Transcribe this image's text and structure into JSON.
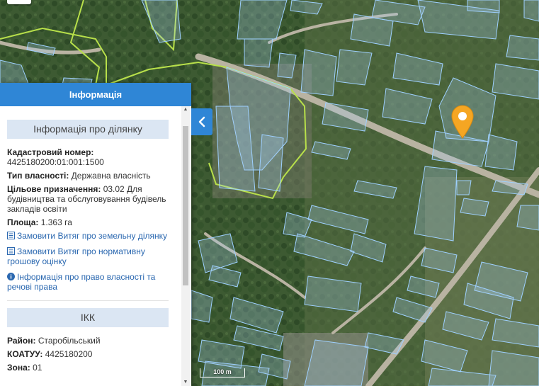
{
  "panel": {
    "title": "Інформація",
    "section_parcel": {
      "title": "Інформація про ділянку",
      "cadastral_label": "Кадастровий номер:",
      "cadastral_value": "4425180200:01:001:1500",
      "ownership_label": "Тип власності:",
      "ownership_value": "Державна власність",
      "purpose_label": "Цільове призначення:",
      "purpose_value": "03.02 Для будівництва та обслуговування будівель закладів освіти",
      "area_label": "Площа:",
      "area_value": "1.363 га"
    },
    "links": {
      "extract_land": "Замовити Витяг про земельну ділянку",
      "extract_valuation": "Замовити Витяг про нормативну грошову оцінку",
      "ownership_info": "Інформація про право власності та речові права"
    },
    "section_ikk": {
      "title": "ІКК",
      "district_label": "Район:",
      "district_value": "Старобільський",
      "koatuu_label": "КОАТУУ:",
      "koatuu_value": "4425180200",
      "zone_label": "Зона:",
      "zone_value": "01"
    }
  },
  "map": {
    "scale_label": "100 m",
    "marker_color": "#f5a623",
    "parcel_outline_color": "#9ed0ff",
    "boundary_color": "#b8e04a"
  }
}
